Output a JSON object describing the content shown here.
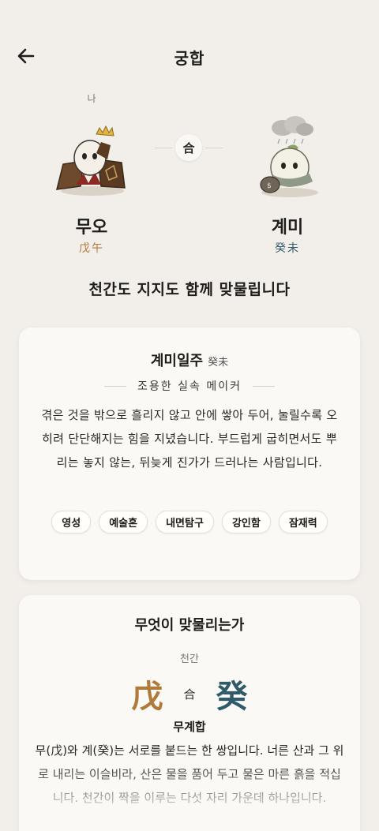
{
  "header": {
    "title": "궁합"
  },
  "me_label": "나",
  "hap_badge": "合",
  "person_left": {
    "name": "무오",
    "hanja": "戊午",
    "color": "#b07a3a"
  },
  "person_right": {
    "name": "계미",
    "hanja": "癸未",
    "color": "#2e5a6a"
  },
  "relation_summary": "천간도 지지도 함께 맞물립니다",
  "ilju_card": {
    "title": "계미일주",
    "title_hanja": "癸未",
    "subtitle": "조용한 실속 메이커",
    "description": "겪은 것을 밖으로 흘리지 않고 안에 쌓아 두어, 눌릴수록 오히려 단단해지는 힘을 지녔습니다. 부드럽게 굽히면서도 뿌리는 놓지 않는, 뒤늦게 진가가 드러나는 사람입니다.",
    "tags": [
      "영성",
      "예술혼",
      "내면탐구",
      "강인함",
      "잠재력"
    ]
  },
  "match_card": {
    "title": "무엇이 맞물리는가",
    "section": "천간",
    "stem_left": "戊",
    "stem_hap": "合",
    "stem_right": "癸",
    "combo_name": "무계합",
    "description": "무(戊)와 계(癸)는 서로를 붙드는 한 쌍입니다. 너른 산과 그 위로 내리는 이슬비라, 산은 물을 품어 두고 물은 마른 흙을 적십니다. 천간이 짝을 이루는 다섯 자리 가운데 하나입니다."
  },
  "colors": {
    "earth": "#b07a3a",
    "water": "#2e5a6a",
    "background": "#f2efea"
  }
}
